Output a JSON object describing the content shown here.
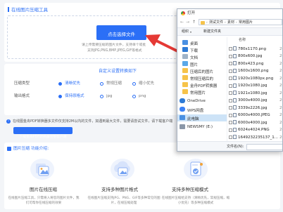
{
  "page": {
    "tool_title": "在线图片压缩工具",
    "upload_button": "点击选择文件",
    "upload_hint_1": "请上传需要压缩的图片文件，支持单个或批",
    "upload_hint_2": "支持JPG,PNG,BMP,JPEG,GIF等格式",
    "settings_title": "自定义设置转换如下",
    "compress_label": "压缩类型",
    "compress_options": [
      "清晰优先",
      "常规压缩",
      "缩小优先"
    ],
    "output_label": "输出格式",
    "output_options": [
      "保持原格式",
      "jpg",
      "png"
    ],
    "notice": "在线图金舟PDF转换器多文件仅支持2M以内的文件，如遇到最大文件，需要请尝试文件，请下载客户端",
    "download_button": "下载金舟PDF转换器完整客户端",
    "features_title": "图片压缩 功能介绍:",
    "features": [
      {
        "title": "图片在线压缩",
        "desc_1": "在线图片压缩工具，只需将入将您的图片文件，我们可帮你在线压缩的效果"
      },
      {
        "title": "支持多种图片格式",
        "desc_1": "在线图片压缩支持JPG、PNG、GIF等多种常见的图片，在线压缩处理"
      },
      {
        "title": "支持多种压缩模式",
        "desc_1": "在线图片压缩给支持（清晰优先，常规压缩，缩小优先）等多种压缩模式"
      }
    ],
    "accent_color": "#2b6ff6",
    "arrow_color": "#e53935"
  },
  "explorer": {
    "title": "打开",
    "breadcrumb": [
      "测试文件",
      "素材",
      "常用图片"
    ],
    "toolbar_organize": "组织",
    "toolbar_new_folder": "新建文件夹",
    "column_name": "名称",
    "nav_items": [
      {
        "label": "桌面",
        "icon": "desktop-icon"
      },
      {
        "label": "下载",
        "icon": "download-icon"
      },
      {
        "label": "文档",
        "icon": "document-icon"
      },
      {
        "label": "图片",
        "icon": "picture-icon"
      },
      {
        "label": "压缩后的图片",
        "icon": "folder-icon"
      },
      {
        "label": "常规压缩后的",
        "icon": "folder-icon"
      },
      {
        "label": "金舟PDF转换器",
        "icon": "folder-icon"
      },
      {
        "label": "常用图片",
        "icon": "folder-icon"
      },
      {
        "label": "OneDrive",
        "icon": "cloud-icon"
      },
      {
        "label": "WPS网盘",
        "icon": "cloud-icon"
      },
      {
        "label": "此电脑",
        "icon": "computer-icon"
      },
      {
        "label": "NEWSMY (E:)",
        "icon": "drive-icon"
      }
    ],
    "files": [
      {
        "name": "780x1170.png",
        "date": "2021/"
      },
      {
        "name": "800x600.jpg",
        "date": "2021/"
      },
      {
        "name": "800x423.png",
        "date": "2021/"
      },
      {
        "name": "1600x1600.png",
        "date": "2021/"
      },
      {
        "name": "1920x1080px.png",
        "date": "2021/"
      },
      {
        "name": "1920x1080.jpg",
        "date": "2021/"
      },
      {
        "name": "1921x1080.jpg",
        "date": "2021/"
      },
      {
        "name": "3000x4000.jpg",
        "date": "2021/"
      },
      {
        "name": "3339x2226.jpg",
        "date": "2021/"
      },
      {
        "name": "6000x4000.JPEG",
        "date": "2021/"
      },
      {
        "name": "6000x4000.jpg",
        "date": "2021/"
      },
      {
        "name": "6024x4024.PNG",
        "date": "2021/"
      },
      {
        "name": "1649232235137_1...",
        "date": "2022/"
      }
    ],
    "filename_label": "文件名(N):"
  }
}
